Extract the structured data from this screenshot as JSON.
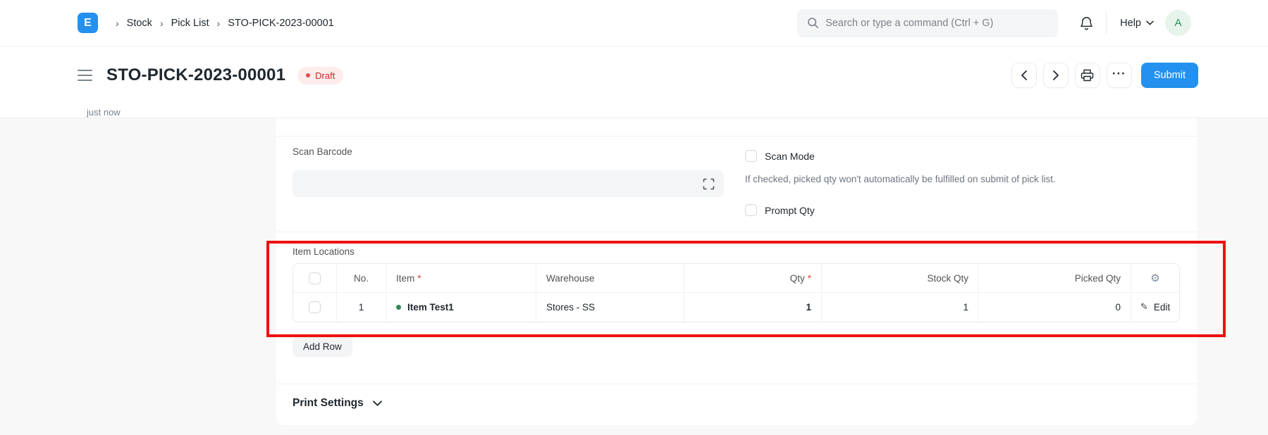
{
  "navbar": {
    "logo_letter": "E",
    "breadcrumbs": [
      {
        "label": "Stock"
      },
      {
        "label": "Pick List"
      },
      {
        "label": "STO-PICK-2023-00001"
      }
    ],
    "separator": "›",
    "search": {
      "placeholder": "Search or type a command (Ctrl + G)"
    },
    "help_label": "Help",
    "avatar_letter": "A"
  },
  "page_head": {
    "title": "STO-PICK-2023-00001",
    "status": "Draft",
    "saved_time": "just now",
    "ellipsis": "···",
    "submit_label": "Submit"
  },
  "form": {
    "scan_barcode": {
      "label": "Scan Barcode",
      "value": "",
      "placeholder": ""
    },
    "scan_mode": {
      "label": "Scan Mode",
      "checked": false,
      "description": "If checked, picked qty won't automatically be fulfilled on submit of pick list."
    },
    "prompt_qty": {
      "label": "Prompt Qty",
      "checked": false
    },
    "item_locations": {
      "label": "Item Locations",
      "columns": {
        "no": "No.",
        "item": "Item",
        "warehouse": "Warehouse",
        "qty": "Qty",
        "stock_qty": "Stock Qty",
        "picked_qty": "Picked Qty"
      },
      "required_marker": "*",
      "rows": [
        {
          "no": "1",
          "item": "Item Test1",
          "warehouse": "Stores - SS",
          "qty": "1",
          "stock_qty": "1",
          "picked_qty": "0",
          "edit_label": "Edit"
        }
      ],
      "add_row_label": "Add Row"
    },
    "print_settings_label": "Print Settings"
  },
  "icons": {
    "gear": "⚙",
    "pencil": "✎"
  },
  "colors": {
    "accent_blue": "#2490ef",
    "status_red_text": "#cb2929",
    "status_red_bg": "#fdecec",
    "item_green": "#2d8a54",
    "annotation_red": "#ee1111",
    "page_bg": "#f8f8f8",
    "input_bg": "#f4f5f6"
  }
}
